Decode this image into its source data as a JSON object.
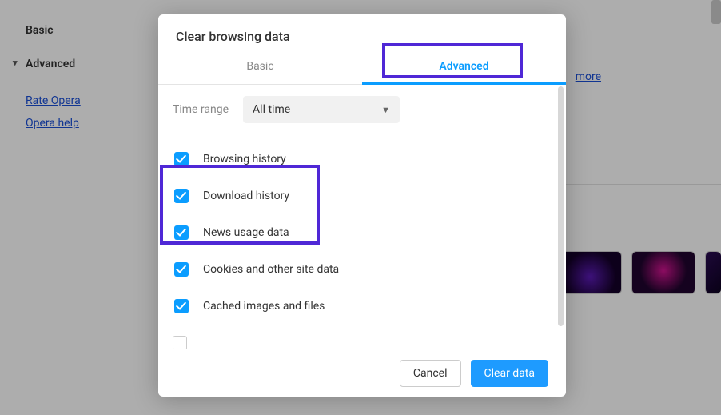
{
  "sidebar": {
    "nav": {
      "basic": "Basic",
      "advanced": "Advanced"
    },
    "links": {
      "rate": "Rate Opera",
      "help": "Opera help"
    }
  },
  "background": {
    "more_link": "more"
  },
  "dialog": {
    "title": "Clear browsing data",
    "tabs": {
      "basic": "Basic",
      "advanced": "Advanced"
    },
    "time_range": {
      "label": "Time range",
      "value": "All time"
    },
    "items": [
      {
        "label": "Browsing history",
        "checked": true
      },
      {
        "label": "Download history",
        "checked": true
      },
      {
        "label": "News usage data",
        "checked": true
      },
      {
        "label": "Cookies and other site data",
        "checked": true
      },
      {
        "label": "Cached images and files",
        "checked": true
      }
    ],
    "footer": {
      "cancel": "Cancel",
      "clear": "Clear data"
    }
  }
}
